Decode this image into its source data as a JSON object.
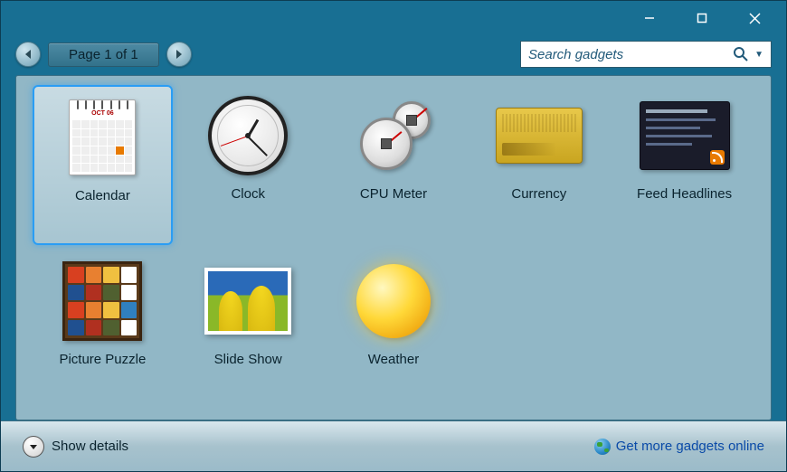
{
  "nav": {
    "page_indicator": "Page 1 of 1"
  },
  "search": {
    "placeholder": "Search gadgets",
    "value": ""
  },
  "gadgets": [
    {
      "id": "calendar",
      "label": "Calendar",
      "selected": true
    },
    {
      "id": "clock",
      "label": "Clock",
      "selected": false
    },
    {
      "id": "cpu-meter",
      "label": "CPU Meter",
      "selected": false
    },
    {
      "id": "currency",
      "label": "Currency",
      "selected": false
    },
    {
      "id": "feed-headlines",
      "label": "Feed Headlines",
      "selected": false
    },
    {
      "id": "picture-puzzle",
      "label": "Picture Puzzle",
      "selected": false
    },
    {
      "id": "slide-show",
      "label": "Slide Show",
      "selected": false
    },
    {
      "id": "weather",
      "label": "Weather",
      "selected": false
    }
  ],
  "footer": {
    "details_label": "Show details",
    "online_link": "Get more gadgets online"
  },
  "calendar_icon": {
    "header": "OCT 06",
    "highlight_index": 26
  },
  "colors": {
    "chrome": "#186f93",
    "panel": "#91b7c6",
    "selection": "#2a9df4",
    "link": "#0a4aa8"
  }
}
